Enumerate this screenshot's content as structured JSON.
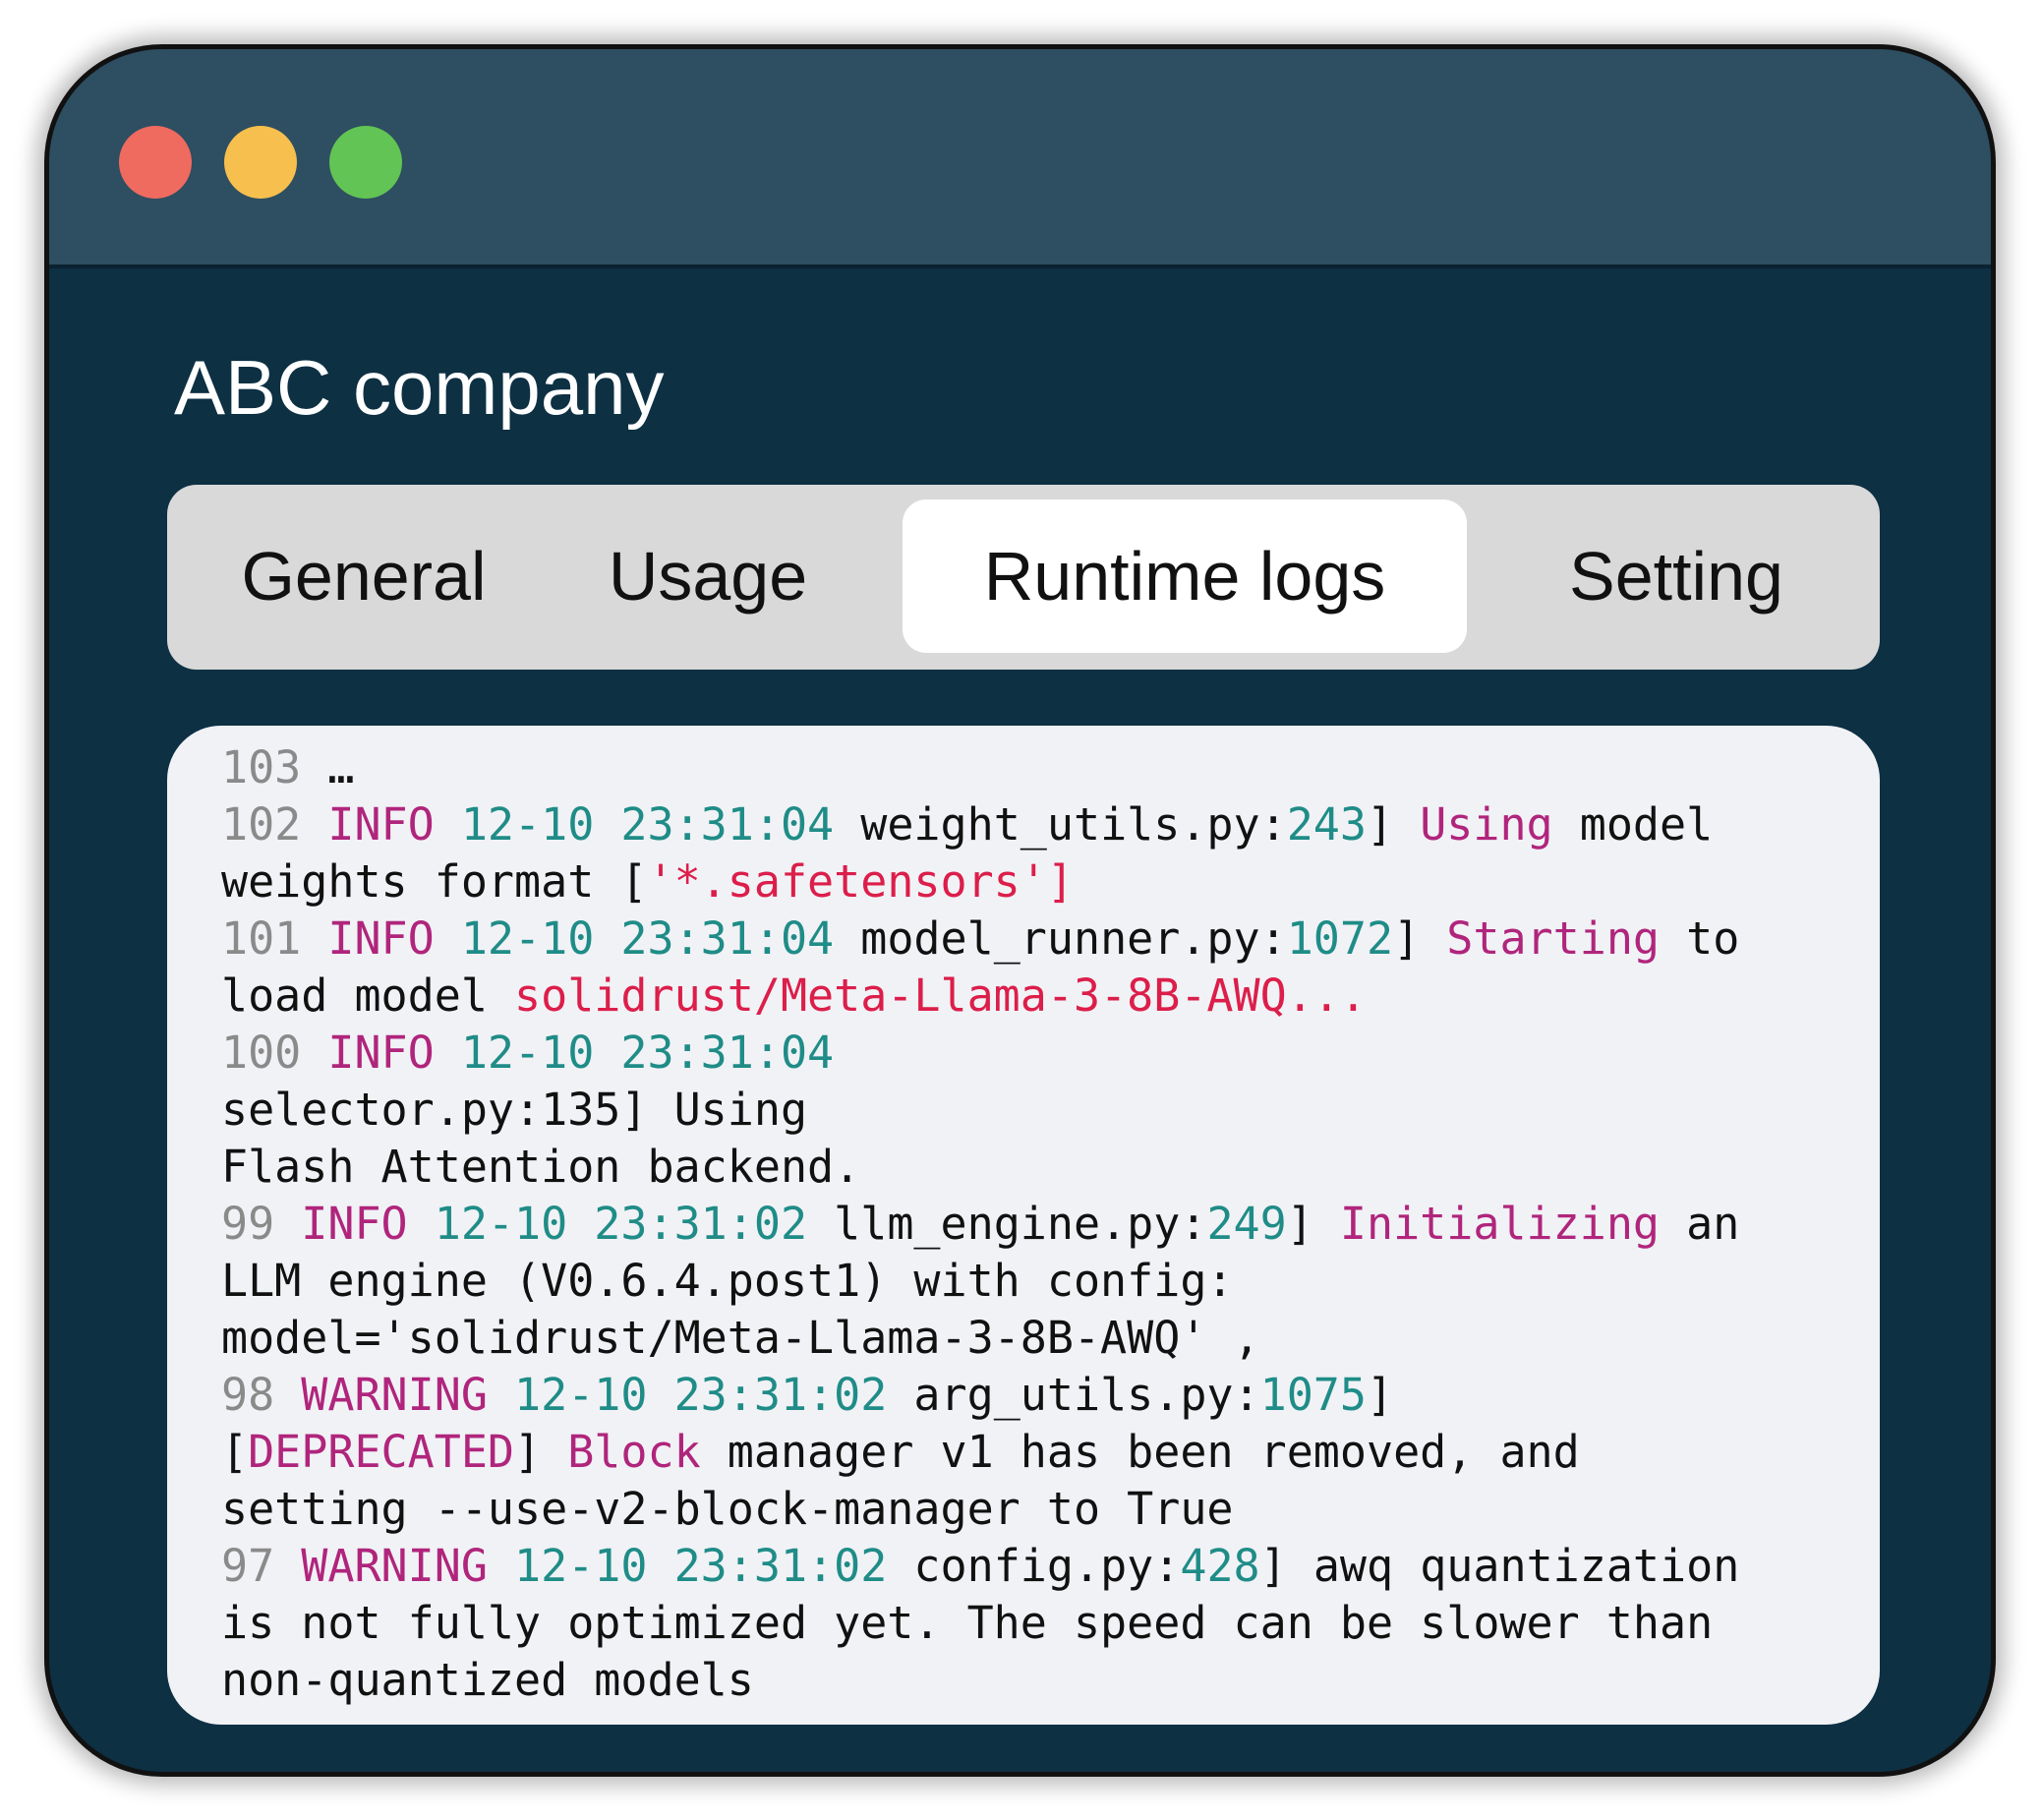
{
  "window": {
    "controls": [
      "close",
      "minimize",
      "maximize"
    ]
  },
  "app": {
    "title": "ABC company"
  },
  "tabs": [
    {
      "label": "General",
      "active": false
    },
    {
      "label": "Usage",
      "active": false
    },
    {
      "label": "Runtime logs",
      "active": true
    },
    {
      "label": "Setting",
      "active": false
    }
  ],
  "logs": {
    "lines": [
      {
        "num": "103",
        "text": " …"
      },
      {
        "num": "102",
        "level": "INFO",
        "time": "12-10 23:31:04",
        "file": "weight_utils.py:",
        "line": "243",
        "msg_key": "Using",
        "msg": " model"
      },
      {
        "text": "weights format [",
        "str": "'*.safetensors'",
        "end": "]"
      },
      {
        "num": "101",
        "level": "INFO",
        "time": "12-10 23:31:04",
        "file": "model_runner.py:",
        "line": "1072",
        "msg_key": "Starting",
        "msg": " to"
      },
      {
        "text": "load model ",
        "str": "solidrust/Meta-Llama-3-8B-AWQ..."
      },
      {
        "num": "100",
        "level": "INFO",
        "time": "12-10 23:31:04"
      },
      {
        "text": "selector.py:135] Using"
      },
      {
        "text": "Flash Attention backend."
      },
      {
        "num": "99",
        "level": "INFO",
        "time": "12-10 23:31:02",
        "file": "llm_engine.py:",
        "line": "249",
        "msg_key": "Initializing",
        "msg": " an"
      },
      {
        "text": "LLM engine (V0.6.4.post1) with config:"
      },
      {
        "text": "model='solidrust/Meta-Llama-3-8B-AWQ' ,"
      },
      {
        "num": "98",
        "level": "WARNING",
        "time": "12-10 23:31:02",
        "file": "arg_utils.py:",
        "line": "1075",
        "end": "]"
      },
      {
        "text": "[",
        "tag": "DEPRECATED",
        "tag_end": "] ",
        "msg_key": "Block",
        "msg": " manager v1 has been removed, and"
      },
      {
        "text": "setting --use-v2-block-manager to True"
      },
      {
        "num": "97",
        "level": "WARNING",
        "time": "12-10 23:31:02",
        "file": "config.py:",
        "line": "428",
        "msg": " awq quantization"
      },
      {
        "text": "is not fully optimized yet. The speed can be slower than"
      },
      {
        "text": "non-quantized models"
      }
    ]
  },
  "colors": {
    "window_bg": "#0d3043",
    "titlebar_bg": "#2e4e61",
    "close": "#ef6b5f",
    "minimize": "#f6bf4e",
    "maximize": "#62c454",
    "tabbar_bg": "#d9d9d9",
    "active_tab_bg": "#ffffff",
    "log_bg": "#f1f2f6",
    "log_number": "#8a8a8a",
    "log_level": "#b0257c",
    "log_time": "#1f8c87",
    "log_string": "#dc1e4a"
  }
}
